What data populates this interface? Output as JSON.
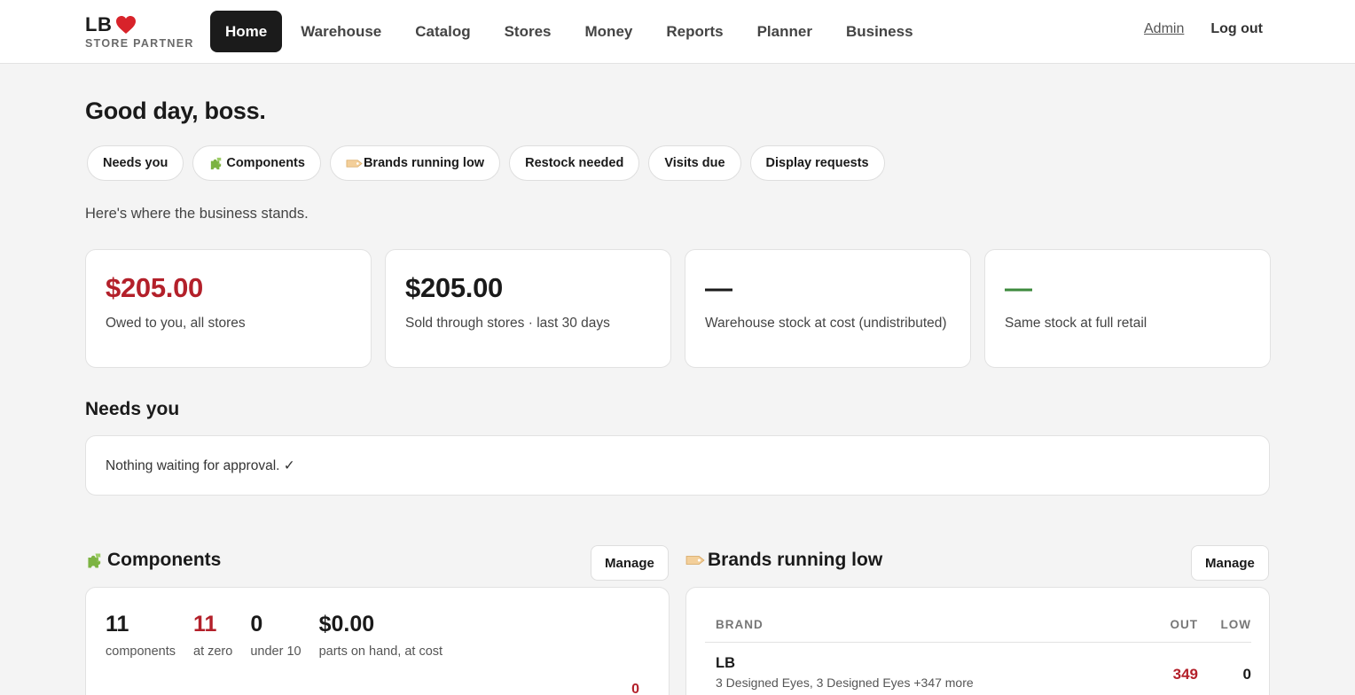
{
  "brand": {
    "name": "LB",
    "tagline": "STORE PARTNER"
  },
  "nav": {
    "items": [
      {
        "label": "Home",
        "active": true
      },
      {
        "label": "Warehouse"
      },
      {
        "label": "Catalog"
      },
      {
        "label": "Stores"
      },
      {
        "label": "Money"
      },
      {
        "label": "Reports"
      },
      {
        "label": "Planner"
      },
      {
        "label": "Business"
      }
    ],
    "admin": "Admin",
    "logout": "Log out"
  },
  "greeting": "Good day, boss.",
  "pills": [
    {
      "label": "Needs you",
      "icon": ""
    },
    {
      "label": "Components",
      "icon": "puzzle-icon"
    },
    {
      "label": "Brands running low",
      "icon": "tag-icon"
    },
    {
      "label": "Restock needed",
      "icon": ""
    },
    {
      "label": "Visits due",
      "icon": ""
    },
    {
      "label": "Display requests",
      "icon": ""
    }
  ],
  "subtitle": "Here's where the business stands.",
  "stats": [
    {
      "value": "$205.00",
      "label": "Owed to you, all stores",
      "color": "#b3202a"
    },
    {
      "value": "$205.00",
      "label": "Sold through stores · last 30 days",
      "color": "#1a1a1a"
    },
    {
      "value": "—",
      "label": "Warehouse stock at cost (undistributed)",
      "color": "#1a1a1a"
    },
    {
      "value": "—",
      "label": "Same stock at full retail",
      "color": "#3d8a3d"
    }
  ],
  "needs_you": {
    "title": "Needs you",
    "message": "Nothing waiting for approval. ✓"
  },
  "components": {
    "title": "Components",
    "manage": "Manage",
    "stats": [
      {
        "value": "11",
        "label": "components",
        "highlight": false
      },
      {
        "value": "11",
        "label": "at zero",
        "highlight": true
      },
      {
        "value": "0",
        "label": "under 10",
        "highlight": false
      },
      {
        "value": "$0.00",
        "label": "parts on hand, at cost",
        "highlight": false
      }
    ],
    "partial_row_value": "0"
  },
  "brands_low": {
    "title": "Brands running low",
    "manage": "Manage",
    "columns": {
      "brand": "BRAND",
      "out": "OUT",
      "low": "LOW"
    },
    "rows": [
      {
        "name": "LB",
        "desc": "3 Designed Eyes, 3 Designed Eyes +347 more",
        "out": "349",
        "low": "0"
      }
    ]
  },
  "colors": {
    "accent_red": "#b3202a",
    "accent_green": "#3d8a3d",
    "nav_active": "#1b1b1b"
  }
}
